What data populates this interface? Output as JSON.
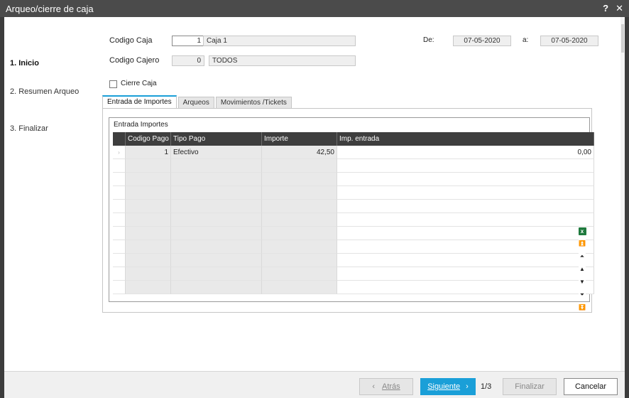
{
  "window": {
    "title": "Arqueo/cierre de caja",
    "help": "?",
    "close": "✕"
  },
  "nav": {
    "items": [
      {
        "label": "1. Inicio"
      },
      {
        "label": "2. Resumen Arqueo"
      },
      {
        "label": "3. Finalizar"
      }
    ]
  },
  "form": {
    "codigo_caja_label": "Codigo Caja",
    "codigo_caja_value": "1",
    "caja_nombre": "Caja 1",
    "codigo_cajero_label": "Codigo Cajero",
    "codigo_cajero_value": "0",
    "cajero_nombre": "TODOS",
    "de_label": "De:",
    "de_value": "07-05-2020",
    "a_label": "a:",
    "a_value": "07-05-2020",
    "cierre_caja_label": "Cierre Caja"
  },
  "tabs": [
    {
      "label": "Entrada de Importes"
    },
    {
      "label": "Arqueos"
    },
    {
      "label": "Movimientos /Tickets"
    }
  ],
  "importes": {
    "group_title": "Entrada Importes",
    "columns": [
      "Codigo Pago",
      "Tipo Pago",
      "Importe",
      "Imp. entrada"
    ],
    "row_marker": "›",
    "rows": [
      {
        "codigo": "1",
        "tipo": "Efectivo",
        "importe": "42,50",
        "entrada": "0,00"
      }
    ]
  },
  "grid_tools": [
    {
      "name": "excel-export-icon",
      "glyph": "x"
    },
    {
      "name": "first-record-icon",
      "glyph": "⏫"
    },
    {
      "name": "prev-page-icon",
      "glyph": "⏶"
    },
    {
      "name": "prev-record-icon",
      "glyph": "▲"
    },
    {
      "name": "next-record-icon",
      "glyph": "▼"
    },
    {
      "name": "next-page-icon",
      "glyph": "⏷"
    },
    {
      "name": "last-record-icon",
      "glyph": "⏬"
    }
  ],
  "footer": {
    "back_label": "Atrás",
    "back_glyph": "‹",
    "next_label": "Siguiente",
    "next_glyph": "›",
    "pager": "1/3",
    "finish_label": "Finalizar",
    "cancel_label": "Cancelar"
  },
  "colors": {
    "accent": "#1a9fd8",
    "titlebar": "#4b4b4b",
    "grid_header": "#3e3e3e"
  }
}
